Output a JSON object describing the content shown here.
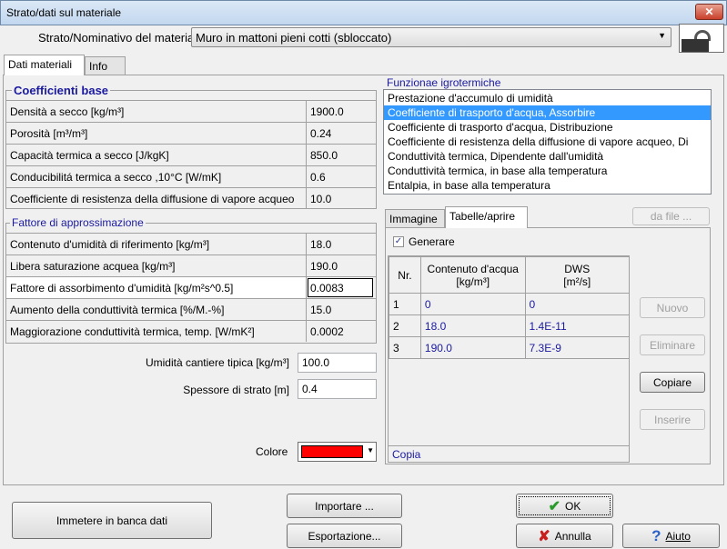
{
  "window": {
    "title": "Strato/dati sul materiale",
    "close": "✕"
  },
  "material": {
    "label": "Strato/Nominativo del materiale",
    "value": "Muro in mattoni pieni cotti (sbloccato)"
  },
  "tabs": [
    "Dati materiali",
    "Info"
  ],
  "base": {
    "title": "Coefficienti base",
    "rows": [
      {
        "label": "Densità a secco [kg/m³]",
        "value": "1900.0"
      },
      {
        "label": "Porosità [m³/m³]",
        "value": "0.24"
      },
      {
        "label": "Capacità termica a secco [J/kgK]",
        "value": "850.0"
      },
      {
        "label": "Conducibilitá termica a secco ,10°C [W/mK]",
        "value": "0.6"
      },
      {
        "label": "Coefficiente di resistenza della diffusione di vapore acqueo",
        "value": "10.0"
      }
    ]
  },
  "approx": {
    "title": "Fattore di approssimazione",
    "rows": [
      {
        "label": "Contenuto d'umidità di riferimento [kg/m³]",
        "value": "18.0"
      },
      {
        "label": "Libera saturazione acquea [kg/m³]",
        "value": "190.0"
      },
      {
        "label": "Fattore di assorbimento d'umidità [kg/m²s^0.5]",
        "value": "0.0083"
      },
      {
        "label": "Aumento della conduttività termica [%/M.-%]",
        "value": "15.0"
      },
      {
        "label": "Maggiorazione conduttività termica, temp. [W/mK²]",
        "value": "0.0002"
      }
    ]
  },
  "moisture": {
    "label": "Umidità cantiere tipica [kg/m³]",
    "value": "100.0"
  },
  "thickness": {
    "label": "Spessore di strato [m]",
    "value": "0.4"
  },
  "color": {
    "label": "Colore",
    "value": "#ff0000"
  },
  "functions": {
    "title": "Funzionae igrotermiche",
    "items": [
      "Prestazione d'accumulo di umidità",
      "Coefficiente di trasporto d'acqua, Assorbire",
      "Coefficiente di trasporto d'acqua, Distribuzione",
      "Coefficiente di resistenza della diffusione di vapore acqueo, Di",
      "Conduttività termica, Dipendente dall'umidità",
      "Conduttività termica, in base alla temperatura",
      "Entalpia, in base alla temperatura"
    ],
    "selected": 1
  },
  "subtabs": [
    "Immagine",
    "Tabelle/aprire"
  ],
  "from_file": "da file ...",
  "generate": {
    "label": "Generare",
    "checked": true
  },
  "table": {
    "headers": [
      [
        "Nr.",
        ""
      ],
      [
        "Contenuto d'acqua",
        "[kg/m³]"
      ],
      [
        "DWS",
        "[m²/s]"
      ]
    ],
    "rows": [
      [
        "1",
        "0",
        "0"
      ],
      [
        "2",
        "18.0",
        "1.4E-11"
      ],
      [
        "3",
        "190.0",
        "7.3E-9"
      ]
    ],
    "footer": "Copia"
  },
  "side_buttons": {
    "new": "Nuovo",
    "delete": "Eliminare",
    "copy": "Copiare",
    "insert": "Inserire"
  },
  "bottom": {
    "database": "Immetere in banca dati",
    "import": "Importare ...",
    "export": "Esportazione...",
    "ok": "OK",
    "cancel": "Annulla",
    "help": "Aiuto"
  }
}
